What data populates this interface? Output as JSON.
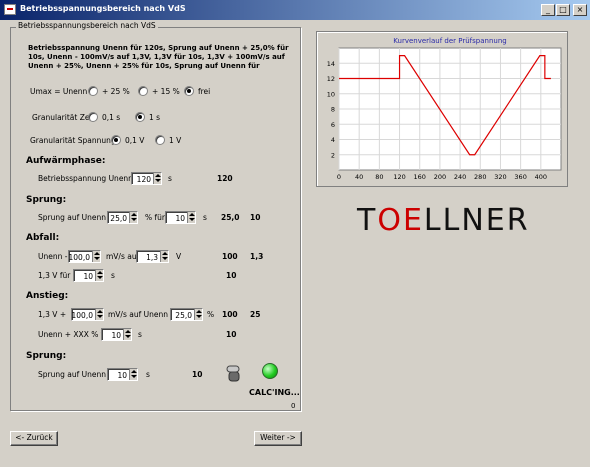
{
  "window": {
    "title": "Betriebsspannungsbereich nach VdS"
  },
  "group": {
    "label": "Betriebsspannungsbereich nach VdS",
    "intro": "Betriebsspannung Unenn für 120s, Sprung auf Unenn + 25,0% für 10s, Unenn - 100mV/s auf 1,3V, 1,3V für 10s, 1,3V + 100mV/s auf Unenn + 25%, Unenn + 25% für 10s, Sprung auf Unenn für"
  },
  "umax": {
    "label": "Umax = Unenn",
    "options": [
      "+ 25 %",
      "+ 15 %",
      "frei"
    ],
    "selected": 2
  },
  "granzeit": {
    "label": "Granularität Zeit",
    "options": [
      "0,1 s",
      "1 s"
    ],
    "selected": 1
  },
  "granspannung": {
    "label": "Granularität Spannung",
    "options": [
      "0,1 V",
      "1 V"
    ],
    "selected": 0
  },
  "aufwaerm": {
    "title": "Aufwärmphase:",
    "label": "Betriebsspannung Unenn für",
    "value": "120",
    "unit": "s",
    "result": "120"
  },
  "sprung1": {
    "title": "Sprung:",
    "label": "Sprung auf Unenn +",
    "value": "25,0",
    "label2": "% für",
    "value2": "10",
    "unit": "s",
    "result1": "25,0",
    "result2": "10"
  },
  "abfall": {
    "title": "Abfall:",
    "label": "Unenn -",
    "value": "100,0",
    "label2": "mV/s auf",
    "value2": "1,3",
    "unit": "V",
    "result1": "100",
    "result2": "1,3",
    "label3": "1,3 V für",
    "value3": "10",
    "unit3": "s",
    "result3": "10"
  },
  "anstieg": {
    "title": "Anstieg:",
    "label": "1,3 V +",
    "value": "100,0",
    "label2": "mV/s auf Unenn +",
    "value2": "25,0",
    "unit": "%",
    "result1": "100",
    "result2": "25",
    "label3": "Unenn + XXX % für",
    "value3": "10",
    "unit3": "s",
    "result3": "10"
  },
  "sprung2": {
    "title": "Sprung:",
    "label": "Sprung auf Unenn für",
    "value": "10",
    "unit": "s",
    "result": "10"
  },
  "status": {
    "text": "CALC'ING...",
    "counter": "0",
    "led_color": "#22cc22"
  },
  "buttons": {
    "back": "<- Zurück",
    "next": "Weiter ->"
  },
  "logo": {
    "text": "TOELLNER",
    "accent": "#cc0000"
  },
  "chart_data": {
    "type": "line",
    "title": "Kurvenverlauf der Prüfspannung",
    "xlim": [
      0,
      440
    ],
    "ylim": [
      0,
      16
    ],
    "xticks": [
      0,
      40,
      80,
      120,
      160,
      200,
      240,
      280,
      320,
      360,
      400
    ],
    "yticks": [
      2,
      4,
      6,
      8,
      10,
      12,
      14
    ],
    "series": [
      {
        "x": [
          0,
          120,
          120,
          130,
          259,
          269,
          398,
          408,
          408,
          420
        ],
        "y": [
          12,
          12,
          15,
          15,
          2,
          2,
          15,
          15,
          12,
          12
        ],
        "color": "#dd0000"
      }
    ],
    "grid": true
  }
}
